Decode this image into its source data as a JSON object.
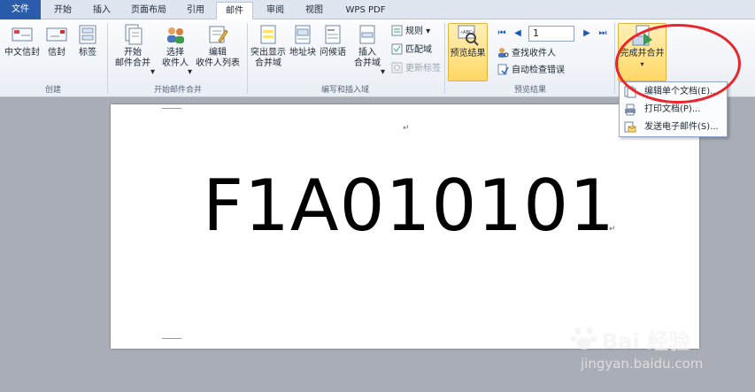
{
  "tabs": [
    {
      "label": "文件"
    },
    {
      "label": "开始"
    },
    {
      "label": "插入"
    },
    {
      "label": "页面布局"
    },
    {
      "label": "引用"
    },
    {
      "label": "邮件"
    },
    {
      "label": "审阅"
    },
    {
      "label": "视图"
    },
    {
      "label": "WPS PDF"
    }
  ],
  "ribbon": {
    "create": {
      "label": "创建",
      "chinese_envelope": "中文信封",
      "envelope": "信封",
      "label_btn": "标签"
    },
    "start_merge": {
      "label": "开始邮件合并",
      "start_l1": "开始",
      "start_l2": "邮件合并",
      "select_l1": "选择",
      "select_l2": "收件人",
      "edit_l1": "编辑",
      "edit_l2": "收件人列表"
    },
    "write_insert": {
      "label": "编写和插入域",
      "highlight_l1": "突出显示",
      "highlight_l2": "合并域",
      "address_block": "地址块",
      "greeting": "问候语",
      "insert_l1": "插入",
      "insert_l2": "合并域",
      "rules": "规则",
      "match_fields": "匹配域",
      "update_labels": "更新标签"
    },
    "preview": {
      "label": "预览结果",
      "preview_results": "预览结果",
      "record": "1",
      "find_recipient": "查找收件人",
      "auto_check": "自动检查错误"
    },
    "finish": {
      "finish_merge": "完成并合并"
    }
  },
  "document": {
    "text": "F1A010101"
  },
  "dropdown": {
    "items": [
      {
        "label": "编辑单个文档(E)..."
      },
      {
        "label": "打印文档(P)..."
      },
      {
        "label": "发送电子邮件(S)..."
      }
    ]
  },
  "watermark": {
    "main": "Bai 经验",
    "sub": "jingyan.baidu.com"
  },
  "colors": {
    "file_tab": "#2a5cab",
    "highlight": "#ffd766",
    "annotation": "#e8262b"
  }
}
